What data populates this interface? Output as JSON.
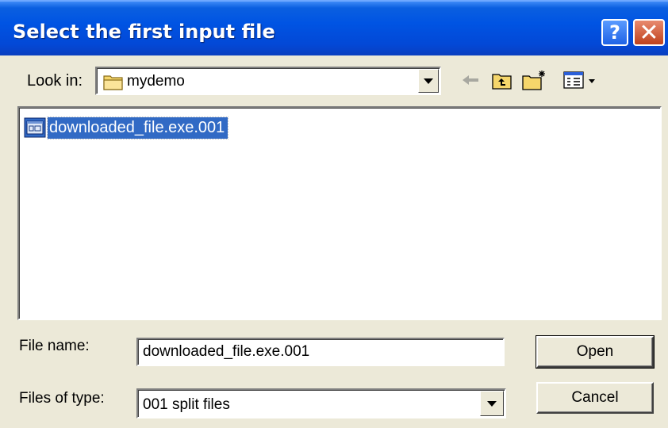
{
  "window": {
    "title": "Select the first input file",
    "help_glyph": "?",
    "close_glyph": "✕"
  },
  "look_in": {
    "label": "Look in:",
    "folder": "mydemo",
    "folder_icon": "folder-icon"
  },
  "toolbar": {
    "icons": [
      "back-arrow-icon",
      "up-one-level-icon",
      "new-folder-icon",
      "views-menu-icon"
    ]
  },
  "file_list": {
    "items": [
      {
        "name": "downloaded_file.exe.001",
        "icon": "file-icon",
        "selected": true
      }
    ]
  },
  "file_name": {
    "label": "File name:",
    "value": "downloaded_file.exe.001"
  },
  "file_type": {
    "label": "Files of type:",
    "value": "001 split files"
  },
  "buttons": {
    "open": "Open",
    "cancel": "Cancel"
  },
  "colors": {
    "title_bar": "#0054e3",
    "selection": "#316ac5",
    "dialog_bg": "#ece9d8",
    "close_button": "#c0411c"
  }
}
